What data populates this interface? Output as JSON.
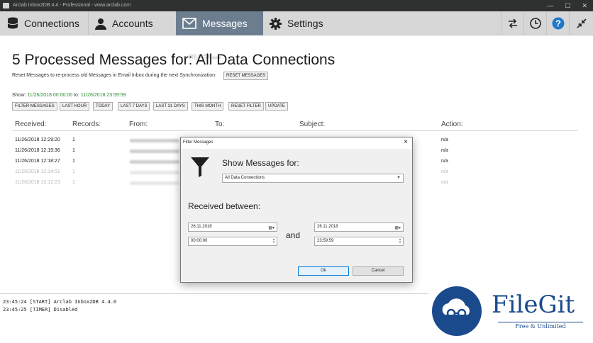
{
  "window": {
    "title": "Arclab Inbox2DB 4.4 - Professional - www.arclab.com"
  },
  "toolbar": {
    "tabs": [
      {
        "label": "Connections",
        "icon": "database-icon"
      },
      {
        "label": "Accounts",
        "icon": "user-icon"
      },
      {
        "label": "Messages",
        "icon": "envelope-icon",
        "active": true
      },
      {
        "label": "Settings",
        "icon": "gear-icon"
      }
    ],
    "right_buttons": [
      "swap-arrows-icon",
      "clock-icon",
      "help-icon",
      "collapse-icon"
    ]
  },
  "page": {
    "title": "5 Processed Messages for: All Data Connections",
    "reset_text": "Reset Messages to re-process old Messages in Email Inbox during the next Synchronization:",
    "reset_button": "RESET MESSAGES",
    "show_prefix": "Show:",
    "date_from": "11/26/2018 00:00:00",
    "to_word": "to:",
    "date_to": "11/26/2018 23:59:59",
    "filter_buttons": [
      "FILTER MESSAGES",
      "LAST HOUR",
      "TODAY",
      "LAST 7 DAYS",
      "LAST 31 DAYS",
      "THIS MONTH",
      "RESET FILTER",
      "UPDATE"
    ]
  },
  "table": {
    "columns": [
      "Received:",
      "Records:",
      "From:",
      "To:",
      "Subject:",
      "Action:"
    ],
    "rows": [
      {
        "received": "11/26/2018 12:29:20",
        "records": "1",
        "action": "n/a",
        "faded": false
      },
      {
        "received": "11/26/2018 12:19:36",
        "records": "1",
        "action": "n/a",
        "faded": false
      },
      {
        "received": "11/26/2018 12:18:27",
        "records": "1",
        "action": "n/a",
        "faded": false
      },
      {
        "received": "11/26/2018 12:14:51",
        "records": "1",
        "action": "n/a",
        "faded": true
      },
      {
        "received": "11/26/2018 12:12:23",
        "records": "1",
        "action": "n/a",
        "faded": true
      }
    ]
  },
  "log": {
    "lines": [
      "23:45:24 [START] Arclab Inbox2DB 4.4.0",
      "23:45:25 [TIMER] Disabled"
    ]
  },
  "dialog": {
    "title": "Filter Messages",
    "show_for_label": "Show Messages for:",
    "connection_value": "All Data Connections",
    "received_between_label": "Received between:",
    "and_label": "and",
    "from_date": "26.11.2018",
    "from_time": "00:00:00",
    "to_date": "26.11.2018",
    "to_time": "23:59:59",
    "ok_label": "Ok",
    "cancel_label": "Cancel"
  },
  "watermarks": {
    "top_text": "FILECR",
    "top_subtext": ".com",
    "brand_name": "FileGit",
    "brand_tagline": "Free & Unlimited"
  },
  "colors": {
    "active_tab": "#6b7d8f",
    "toolbar_bg": "#d7d7d7",
    "date_green": "#2e8a2e",
    "help_blue": "#1e78c8",
    "brand_blue": "#1a4a8b"
  }
}
